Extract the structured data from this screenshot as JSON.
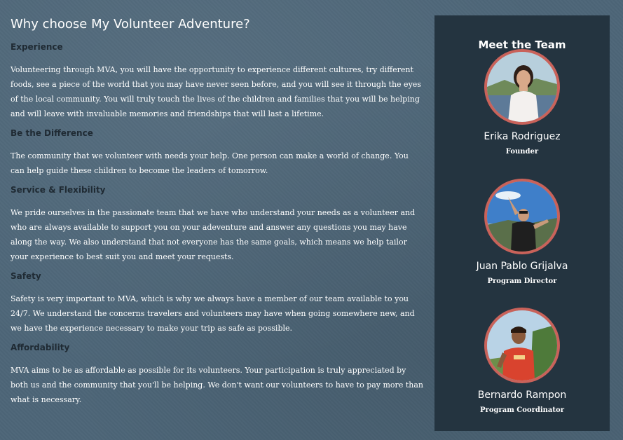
{
  "page": {
    "title": "Why choose My Volunteer Adventure?"
  },
  "sections": [
    {
      "heading": "Experience",
      "body": "Volunteering through MVA, you will have the opportunity to experience different cultures, try different foods, see a piece of the world that you may have never seen before, and you will see it through the eyes of the local community. You will truly touch the lives of the children and families that you will be helping and will leave with invaluable memories and friendships that will last a lifetime."
    },
    {
      "heading": "Be the Difference",
      "body": "The community that we volunteer with needs your help. One person can make a world of change. You can help guide these children to become the leaders of tomorrow."
    },
    {
      "heading": "Service & Flexibility",
      "body": "We pride ourselves in the passionate team that we have who understand your needs as a volunteer and who are always available to support you on your adeventure and answer any questions you may have along the way. We also understand that not everyone has the same goals, which means we help tailor your experience to best suit you and meet your requests."
    },
    {
      "heading": "Safety",
      "body": "Safety is very important to MVA, which is why we always have a member of our team available to you 24/7. We understand the concerns travelers and volunteers may have when going somewhere new, and we have the experience necessary to make your trip as safe as possible."
    },
    {
      "heading": "Affordability",
      "body": "MVA aims to be as affordable as possible for its volunteers. Your participation is truly appreciated by both us and the community that you'll be helping. We don't want our volunteers to have to pay more than what is necessary."
    }
  ],
  "sidebar": {
    "title": "Meet the Team",
    "members": [
      {
        "name": "Erika Rodriguez",
        "role": "Founder",
        "photo_icon": "person-photo"
      },
      {
        "name": "Juan Pablo Grijalva",
        "role": "Program Director",
        "photo_icon": "person-photo"
      },
      {
        "name": "Bernardo Rampon",
        "role": "Program Coordinator",
        "photo_icon": "person-photo"
      }
    ]
  },
  "colors": {
    "background": "#4d6678",
    "sidebar": "#243440",
    "avatar_border": "#c9625a",
    "heading": "#1f2a33",
    "text": "#ffffff"
  }
}
